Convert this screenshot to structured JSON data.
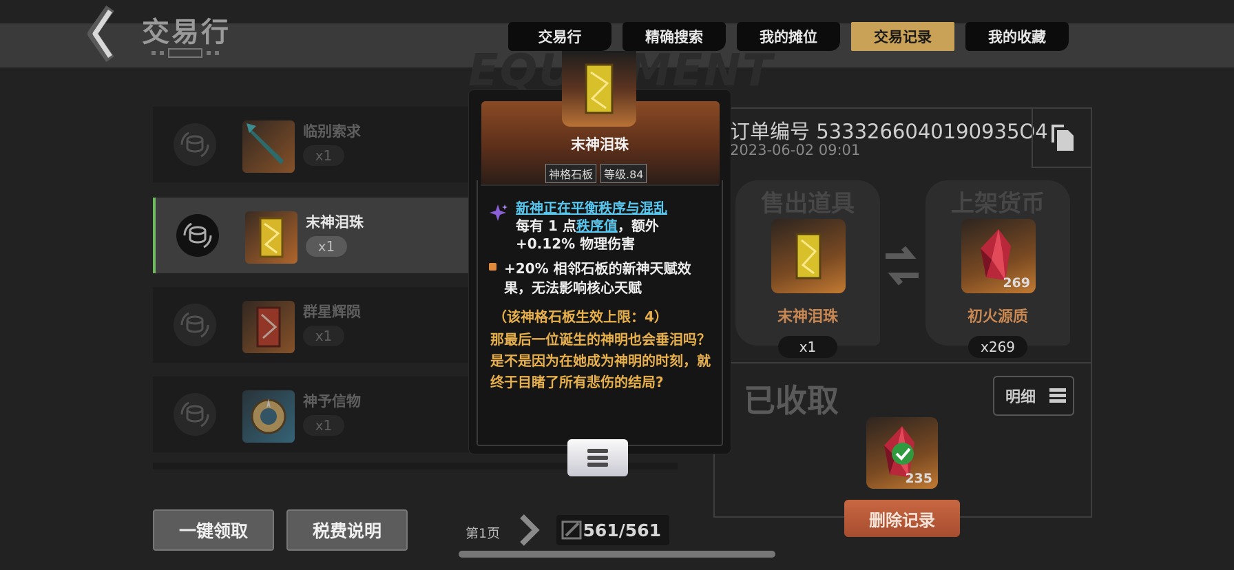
{
  "header": {
    "title": "交易行",
    "watermark": "EQUIPMENT"
  },
  "tabs": [
    {
      "label": "交易行",
      "active": false
    },
    {
      "label": "精确搜索",
      "active": false
    },
    {
      "label": "我的摊位",
      "active": false
    },
    {
      "label": "交易记录",
      "active": true
    },
    {
      "label": "我的收藏",
      "active": false
    }
  ],
  "records": [
    {
      "name": "临别索求",
      "qty": "x1",
      "icon": "spear-icon"
    },
    {
      "name": "末神泪珠",
      "qty": "x1",
      "icon": "gold-tablet-icon",
      "selected": true
    },
    {
      "name": "群星辉陨",
      "qty": "x1",
      "icon": "red-tablet-icon"
    },
    {
      "name": "神予信物",
      "qty": "x1",
      "icon": "emblem-icon"
    }
  ],
  "footer": {
    "claim_all": "一键领取",
    "tax_info": "税费说明",
    "page_label": "第1页",
    "count": "561/561"
  },
  "tooltip": {
    "item_name": "末神泪珠",
    "tags": [
      "神格石板",
      "等级.84"
    ],
    "set_title": "新神正在平衡秩序与混乱",
    "set_line1_a": "每有 1 点",
    "set_line1_link": "秩序值",
    "set_line1_b": "，额外",
    "set_line2": "+0.12% 物理伤害",
    "effect_line1": "+20% 相邻石板的新神天赋效",
    "effect_line2": "果，无法影响核心天赋",
    "limit": "（该神格石板生效上限：4）",
    "flavor": "那最后一位诞生的神明也会垂泪吗？是不是因为在她成为神明的时刻，就终于目睹了所有悲伤的结局?"
  },
  "detail": {
    "order_label": "订单编号 5333266040190935O4",
    "order_date": "2023-06-02 09:01",
    "sold_header": "售出道具",
    "sold_name": "末神泪珠",
    "sold_qty": "x1",
    "price_header": "上架货币",
    "price_name": "初火源质",
    "price_badge": "269",
    "price_qty": "x269",
    "received_label": "已收取",
    "detail_btn": "明细",
    "received_badge": "235",
    "delete_btn": "删除记录"
  },
  "colors": {
    "accent_gold": "#c9a257",
    "select_green": "#6fba5e",
    "link_blue": "#58c8f0",
    "flavor_gold": "#e8b04a",
    "delete_red": "#b85436"
  }
}
